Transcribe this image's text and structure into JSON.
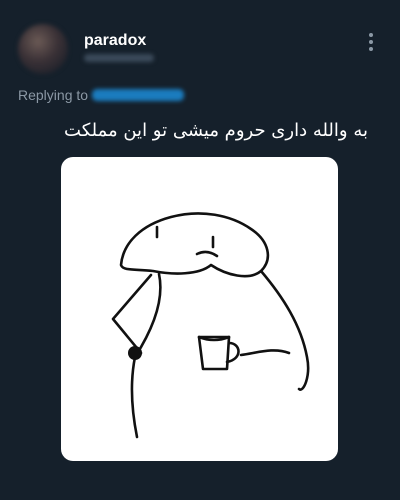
{
  "tweet": {
    "author_name": "paradox",
    "replying_prefix": "Replying to",
    "text": "به والله داری حروم میشی تو این مملکت"
  },
  "media": {
    "description_icon": "flork-meme-drawing"
  },
  "colors": {
    "background": "#15202b",
    "secondary_text": "#8b98a5",
    "link": "#1d9bf0"
  }
}
